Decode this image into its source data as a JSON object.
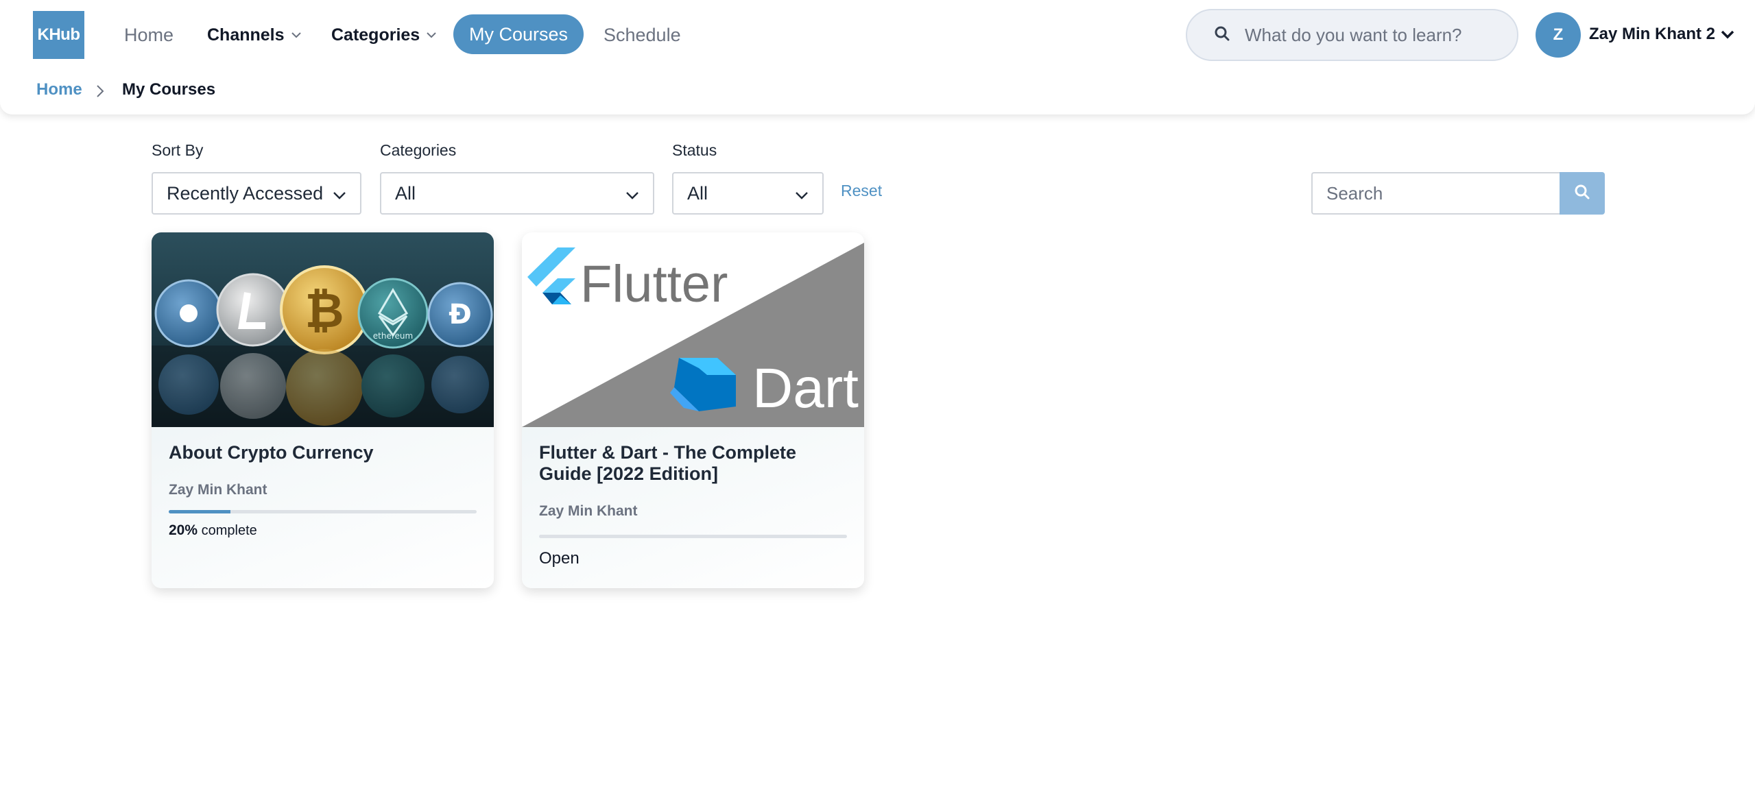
{
  "brand": {
    "logo_text": "KHub"
  },
  "nav": {
    "home": "Home",
    "channels": "Channels",
    "categories": "Categories",
    "my_courses": "My Courses",
    "schedule": "Schedule"
  },
  "top_search": {
    "placeholder": "What do you want to learn?"
  },
  "user": {
    "initial": "Z",
    "name": "Zay Min Khant 2"
  },
  "breadcrumb": {
    "home": "Home",
    "current": "My Courses"
  },
  "filters": {
    "sort_label": "Sort By",
    "sort_value": "Recently Accessed",
    "categories_label": "Categories",
    "categories_value": "All",
    "status_label": "Status",
    "status_value": "All",
    "reset": "Reset",
    "search_placeholder": "Search"
  },
  "courses": [
    {
      "title": "About Crypto Currency",
      "author": "Zay Min Khant",
      "progress_percent": 20,
      "progress_text": "20%",
      "complete_text": "complete",
      "thumbnail_text": [
        "ethereum"
      ]
    },
    {
      "title": "Flutter & Dart - The Complete Guide [2022 Edition]",
      "author": "Zay Min Khant",
      "progress_percent": 0,
      "status_text": "Open",
      "thumbnail_text": [
        "Flutter",
        "Dart"
      ]
    }
  ],
  "colors": {
    "accent": "#4f91c3",
    "search_button": "#8fb9dd"
  },
  "icons": [
    "search-icon",
    "chevron-down-icon",
    "chevron-right-icon"
  ]
}
